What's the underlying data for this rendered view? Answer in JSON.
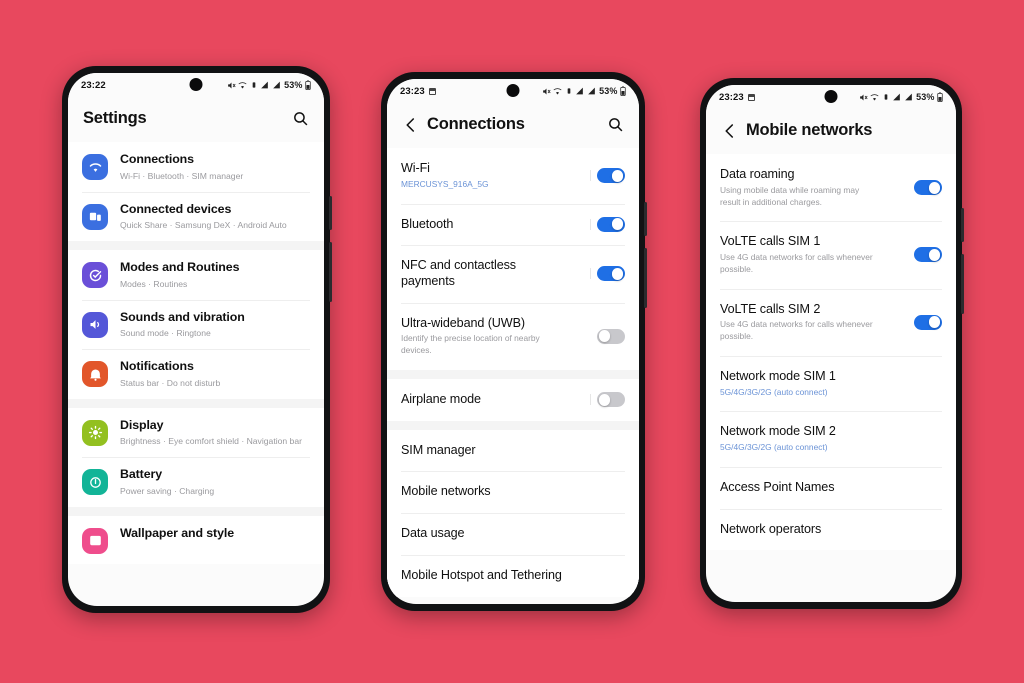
{
  "background_color": "#e8485e",
  "accent_on_color": "#1f6fe5",
  "toggle_off_color": "#c8c8cc",
  "phones": [
    {
      "id": "settings",
      "status": {
        "time": "23:22",
        "battery_percent": "53%",
        "has_calendar_icon": false
      },
      "header": {
        "title": "Settings",
        "has_back": false,
        "has_search": true
      },
      "groups": [
        {
          "rows": [
            {
              "title": "Connections",
              "sub": "Wi-Fi  ·  Bluetooth  ·  SIM manager",
              "icon": "wifi-icon",
              "icon_color": "#3b6fe0"
            },
            {
              "title": "Connected devices",
              "sub": "Quick Share  ·  Samsung DeX  ·  Android Auto",
              "icon": "devices-icon",
              "icon_color": "#3b6fe0"
            }
          ]
        },
        {
          "rows": [
            {
              "title": "Modes and Routines",
              "sub": "Modes  ·  Routines",
              "icon": "modes-icon",
              "icon_color": "#6a4fd8"
            },
            {
              "title": "Sounds and vibration",
              "sub": "Sound mode  ·  Ringtone",
              "icon": "sound-icon",
              "icon_color": "#5457d8"
            },
            {
              "title": "Notifications",
              "sub": "Status bar  ·  Do not disturb",
              "icon": "notifications-icon",
              "icon_color": "#e2562a"
            }
          ]
        },
        {
          "rows": [
            {
              "title": "Display",
              "sub": "Brightness  ·  Eye comfort shield  ·  Navigation bar",
              "icon": "display-icon",
              "icon_color": "#9bc залив"
            },
            {
              "title": "Battery",
              "sub": "Power saving  ·  Charging",
              "icon": "battery-icon",
              "icon_color": "#12b497"
            }
          ]
        },
        {
          "rows": [
            {
              "title": "Wallpaper and style",
              "sub": "",
              "icon": "wallpaper-icon",
              "icon_color": "#ef4d8c"
            }
          ]
        }
      ]
    },
    {
      "id": "connections",
      "status": {
        "time": "23:23",
        "battery_percent": "53%",
        "has_calendar_icon": true
      },
      "header": {
        "title": "Connections",
        "has_back": true,
        "has_search": true
      },
      "groups": [
        {
          "rows": [
            {
              "title": "Wi-Fi",
              "sub": "MERCUSYS_916A_5G",
              "sub_style": "blue",
              "toggle": "on"
            },
            {
              "title": "Bluetooth",
              "sub": "",
              "toggle": "on"
            },
            {
              "title": "NFC and contactless payments",
              "sub": "",
              "toggle": "on"
            },
            {
              "title": "Ultra-wideband (UWB)",
              "sub": "Identify the precise location of nearby devices.",
              "toggle": "off"
            }
          ]
        },
        {
          "rows": [
            {
              "title": "Airplane mode",
              "sub": "",
              "toggle": "off"
            }
          ]
        },
        {
          "rows": [
            {
              "title": "SIM manager",
              "sub": ""
            },
            {
              "title": "Mobile networks",
              "sub": ""
            },
            {
              "title": "Data usage",
              "sub": ""
            },
            {
              "title": "Mobile Hotspot and Tethering",
              "sub": ""
            }
          ]
        }
      ]
    },
    {
      "id": "mobile-networks",
      "status": {
        "time": "23:23",
        "battery_percent": "53%",
        "has_calendar_icon": true
      },
      "header": {
        "title": "Mobile networks",
        "has_back": true,
        "has_search": false
      },
      "groups": [
        {
          "rows": [
            {
              "title": "Data roaming",
              "sub": "Using mobile data while roaming may result in additional charges.",
              "toggle": "on"
            },
            {
              "title": "VoLTE calls SIM 1",
              "sub": "Use 4G data networks for calls whenever possible.",
              "toggle": "on"
            },
            {
              "title": "VoLTE calls SIM 2",
              "sub": "Use 4G data networks for calls whenever possible.",
              "toggle": "on"
            },
            {
              "title": "Network mode SIM 1",
              "sub": "5G/4G/3G/2G (auto connect)",
              "sub_style": "blue"
            },
            {
              "title": "Network mode SIM 2",
              "sub": "5G/4G/3G/2G (auto connect)",
              "sub_style": "blue"
            },
            {
              "title": "Access Point Names",
              "sub": ""
            },
            {
              "title": "Network operators",
              "sub": ""
            }
          ]
        }
      ]
    }
  ]
}
